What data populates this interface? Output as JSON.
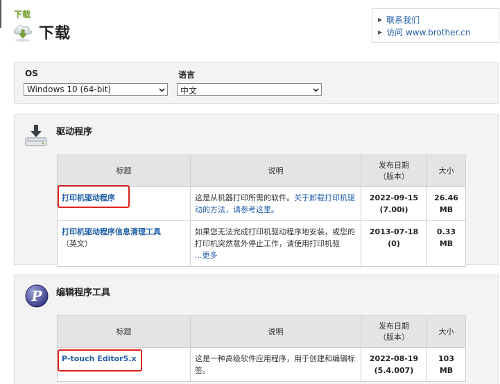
{
  "breadcrumb": "下载",
  "page_title": "下载",
  "links": {
    "contact": "联系我们",
    "visit": "访问 www.brother.cn"
  },
  "os": {
    "label": "OS",
    "value": "Windows 10 (64-bit)"
  },
  "language": {
    "label": "语言",
    "value": "中文"
  },
  "headers": {
    "title": "标题",
    "desc": "说明",
    "date_line1": "发布日期",
    "date_line2": "（版本）",
    "size": "大小"
  },
  "sections": {
    "drivers": {
      "title": "驱动程序",
      "rows": [
        {
          "title": "打印机驱动程序",
          "note": "",
          "desc_text": "这是从机器打印所需的软件。",
          "desc_link": "关于卸载打印机驱动的方法，请参考这里。",
          "desc_more": "",
          "date": "2022-09-15",
          "version": "(7.00i)",
          "size_num": "26.46",
          "size_unit": "MB"
        },
        {
          "title": "打印机驱动程序信息清理工具",
          "note": "（英文）",
          "desc_text": "如果您无法完成打印机驱动程序地安装，或您的打印机突然意外停止工作，请使用打印机驱",
          "desc_link": "",
          "desc_more": "...更多",
          "date": "2013-07-18",
          "version": "(0)",
          "size_num": "0.33",
          "size_unit": "MB"
        }
      ]
    },
    "editor": {
      "title": "编辑程序工具",
      "rows": [
        {
          "title": "P-touch Editor5.x",
          "desc_text": "这是一种高级软件应用程序，用于创建和编辑标签。",
          "date": "2022-08-19",
          "version": "(5.4.007)",
          "size_num": "103",
          "size_unit": "MB"
        }
      ]
    }
  },
  "colors": {
    "link": "#1f5fa8",
    "breadcrumb": "#6b9a1f",
    "highlight": "#e0211c"
  },
  "icons": [
    "cloud-download-icon",
    "chevron-right-icon",
    "driver-download-icon",
    "p-touch-logo-icon"
  ]
}
